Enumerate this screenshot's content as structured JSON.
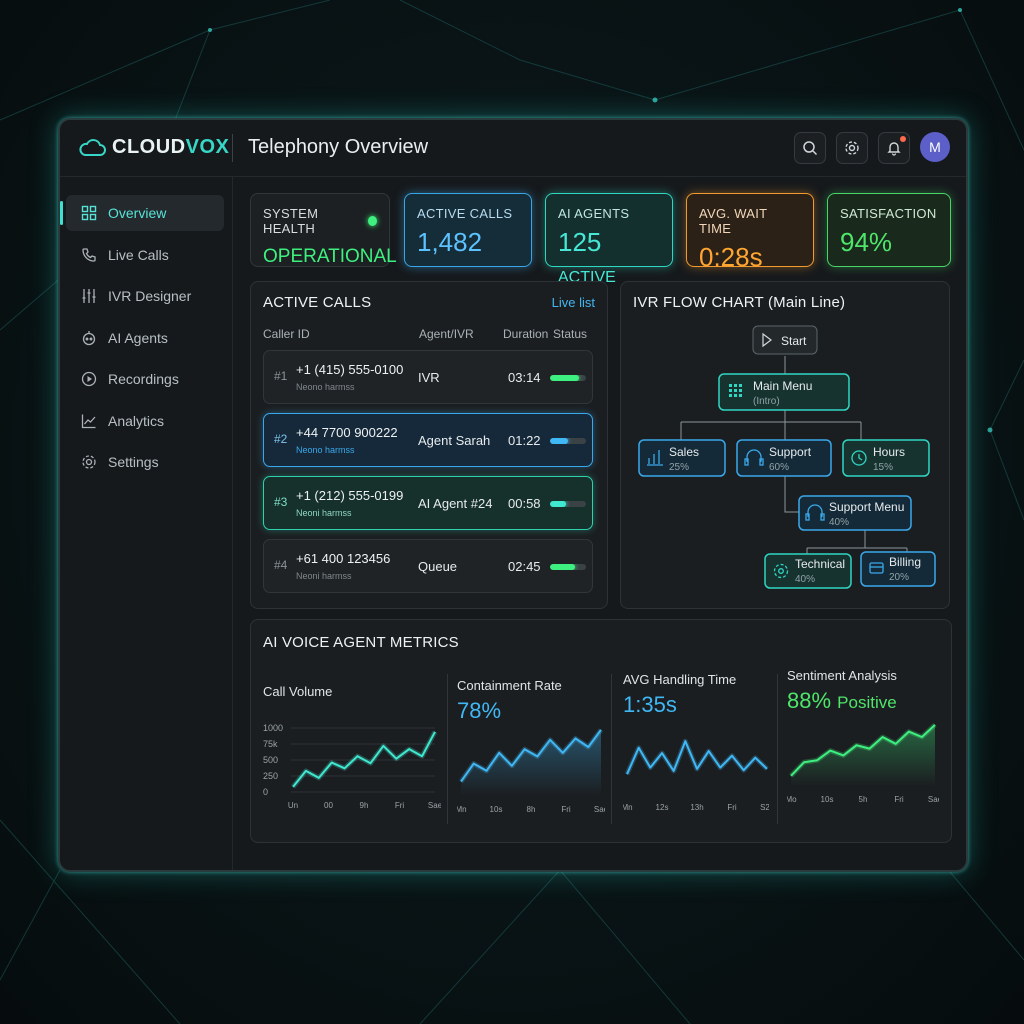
{
  "app": {
    "logo_main": "CLOUD",
    "logo_accent": "VOX",
    "page_title": "Telephony Overview",
    "avatar_initial": "M"
  },
  "top_icons": [
    "search-icon",
    "settings-icon",
    "bell-icon"
  ],
  "sidebar": {
    "items": [
      {
        "label": "Overview",
        "icon": "grid-icon",
        "active": true
      },
      {
        "label": "Live Calls",
        "icon": "phone-icon"
      },
      {
        "label": "IVR Designer",
        "icon": "sliders-icon"
      },
      {
        "label": "AI Agents",
        "icon": "robot-icon"
      },
      {
        "label": "Recordings",
        "icon": "play-circle-icon"
      },
      {
        "label": "Analytics",
        "icon": "line-chart-icon"
      },
      {
        "label": "Settings",
        "icon": "gear-icon"
      }
    ]
  },
  "stats": {
    "health": {
      "label": "SYSTEM HEALTH",
      "value": "OPERATIONAL"
    },
    "active_calls": {
      "label": "ACTIVE CALLS",
      "value": "1,482"
    },
    "ai_agents": {
      "label": "AI AGENTS",
      "value": "125",
      "suffix": "ACTIVE"
    },
    "wait_time": {
      "label": "AVG. WAIT TIME",
      "value": "0:28s"
    },
    "satisfaction": {
      "label": "SATISFACTION",
      "value": "94%"
    }
  },
  "active_calls": {
    "title": "ACTIVE CALLS",
    "link": "Live list",
    "columns": {
      "caller": "Caller ID",
      "agent": "Agent/IVR",
      "duration": "Duration",
      "status": "Status"
    },
    "rows": [
      {
        "num": "#1",
        "phone": "+1 (415) 555-0100",
        "sub": "Neono harmss",
        "agent": "IVR",
        "duration": "03:14",
        "status": 0.8,
        "status_color": "#3ef07f"
      },
      {
        "num": "#2",
        "phone": "+44 7700 900222",
        "sub": "Neono harmss",
        "agent": "Agent Sarah",
        "duration": "01:22",
        "status": 0.5,
        "status_color": "#3fb8f5"
      },
      {
        "num": "#3",
        "phone": "+1 (212) 555-0199",
        "sub": "Neoni harmss",
        "agent": "AI Agent #24",
        "duration": "00:58",
        "status": 0.45,
        "status_color": "#3fe8d0"
      },
      {
        "num": "#4",
        "phone": "+61 400 123456",
        "sub": "Neoni harmss",
        "agent": "Queue",
        "duration": "02:45",
        "status": 0.7,
        "status_color": "#3ef07f"
      }
    ]
  },
  "ivr": {
    "title": "IVR FLOW CHART (Main Line)",
    "start": "Start",
    "main_menu": {
      "label": "Main Menu",
      "sub": "(Intro)"
    },
    "sales": {
      "label": "Sales",
      "pct": "25%"
    },
    "support": {
      "label": "Support",
      "pct": "60%"
    },
    "hours": {
      "label": "Hours",
      "pct": "15%"
    },
    "support_menu": {
      "label": "Support Menu",
      "pct": "40%"
    },
    "technical": {
      "label": "Technical",
      "pct": "40%"
    },
    "billing": {
      "label": "Billing",
      "pct": "20%"
    }
  },
  "metrics": {
    "title": "AI VOICE AGENT METRICS",
    "call_volume": {
      "label": "Call Volume"
    },
    "containment": {
      "label": "Containment Rate",
      "value": "78%"
    },
    "handling": {
      "label": "AVG Handling Time",
      "value": "1:35s"
    },
    "sentiment": {
      "label": "Sentiment Analysis",
      "value": "88%",
      "value_suffix": "Positive"
    }
  },
  "chart_data": [
    {
      "type": "line",
      "title": "Call Volume",
      "yticks": [
        "1000",
        "75k",
        "500",
        "250",
        "0"
      ],
      "ylim": [
        0,
        1000
      ],
      "x": [
        "Un",
        "00",
        "9h",
        "Fri",
        "Sae"
      ],
      "series": [
        {
          "values": [
            80,
            330,
            220,
            460,
            370,
            560,
            450,
            720,
            520,
            670,
            560,
            940
          ]
        }
      ],
      "grid": true,
      "color": "#3fe8d0"
    },
    {
      "type": "area",
      "title": "Containment Rate",
      "x": [
        "Mn",
        "10s",
        "8h",
        "Fri",
        "Sae"
      ],
      "series": [
        {
          "values": [
            20,
            45,
            35,
            60,
            42,
            65,
            55,
            78,
            60,
            80,
            68,
            92
          ]
        }
      ],
      "color": "#3fb8f5"
    },
    {
      "type": "line",
      "title": "AVG Handling Time",
      "x": [
        "Mn",
        "12s",
        "13h",
        "Fri",
        "S2s"
      ],
      "series": [
        {
          "values": [
            30,
            70,
            40,
            62,
            35,
            80,
            38,
            65,
            40,
            58,
            36,
            55,
            38
          ]
        }
      ],
      "color": "#3fb8f5"
    },
    {
      "type": "area",
      "title": "Sentiment Analysis",
      "x": [
        "Mo",
        "10s",
        "5h",
        "Fri",
        "Sae"
      ],
      "series": [
        {
          "values": [
            15,
            35,
            38,
            52,
            45,
            60,
            55,
            72,
            62,
            80,
            72,
            90
          ]
        }
      ],
      "color": "#3ef07f"
    }
  ]
}
